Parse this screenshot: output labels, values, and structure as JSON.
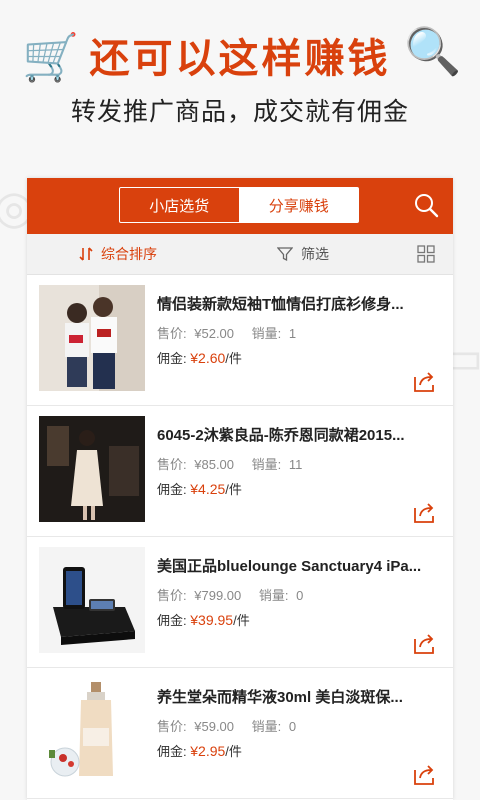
{
  "hero": {
    "title": "还可以这样赚钱",
    "subtitle": "转发推广商品，成交就有佣金"
  },
  "header": {
    "tabs": [
      {
        "label": "小店选货",
        "active": false
      },
      {
        "label": "分享赚钱",
        "active": true
      }
    ],
    "search_icon": "search-icon"
  },
  "toolbar": {
    "sort_label": "综合排序",
    "filter_label": "筛选",
    "grid_icon": "grid-view-icon"
  },
  "colors": {
    "accent": "#d9410d",
    "toolbar_bg": "#f2f2f2"
  },
  "products": [
    {
      "title": "情侣装新款短袖T恤情侣打底衫修身...",
      "price_label": "售价:",
      "price": "¥52.00",
      "sales_label": "销量:",
      "sales": "1",
      "commission_label": "佣金:",
      "commission": "¥2.60",
      "commission_unit": "/件"
    },
    {
      "title": "6045-2沐紫良品-陈乔恩同款裙2015...",
      "price_label": "售价:",
      "price": "¥85.00",
      "sales_label": "销量:",
      "sales": "11",
      "commission_label": "佣金:",
      "commission": "¥4.25",
      "commission_unit": "/件"
    },
    {
      "title": "美国正品bluelounge Sanctuary4 iPa...",
      "price_label": "售价:",
      "price": "¥799.00",
      "sales_label": "销量:",
      "sales": "0",
      "commission_label": "佣金:",
      "commission": "¥39.95",
      "commission_unit": "/件"
    },
    {
      "title": "养生堂朵而精华液30ml 美白淡斑保...",
      "price_label": "售价:",
      "price": "¥59.00",
      "sales_label": "销量:",
      "sales": "0",
      "commission_label": "佣金:",
      "commission": "¥2.95",
      "commission_unit": "/件"
    }
  ]
}
